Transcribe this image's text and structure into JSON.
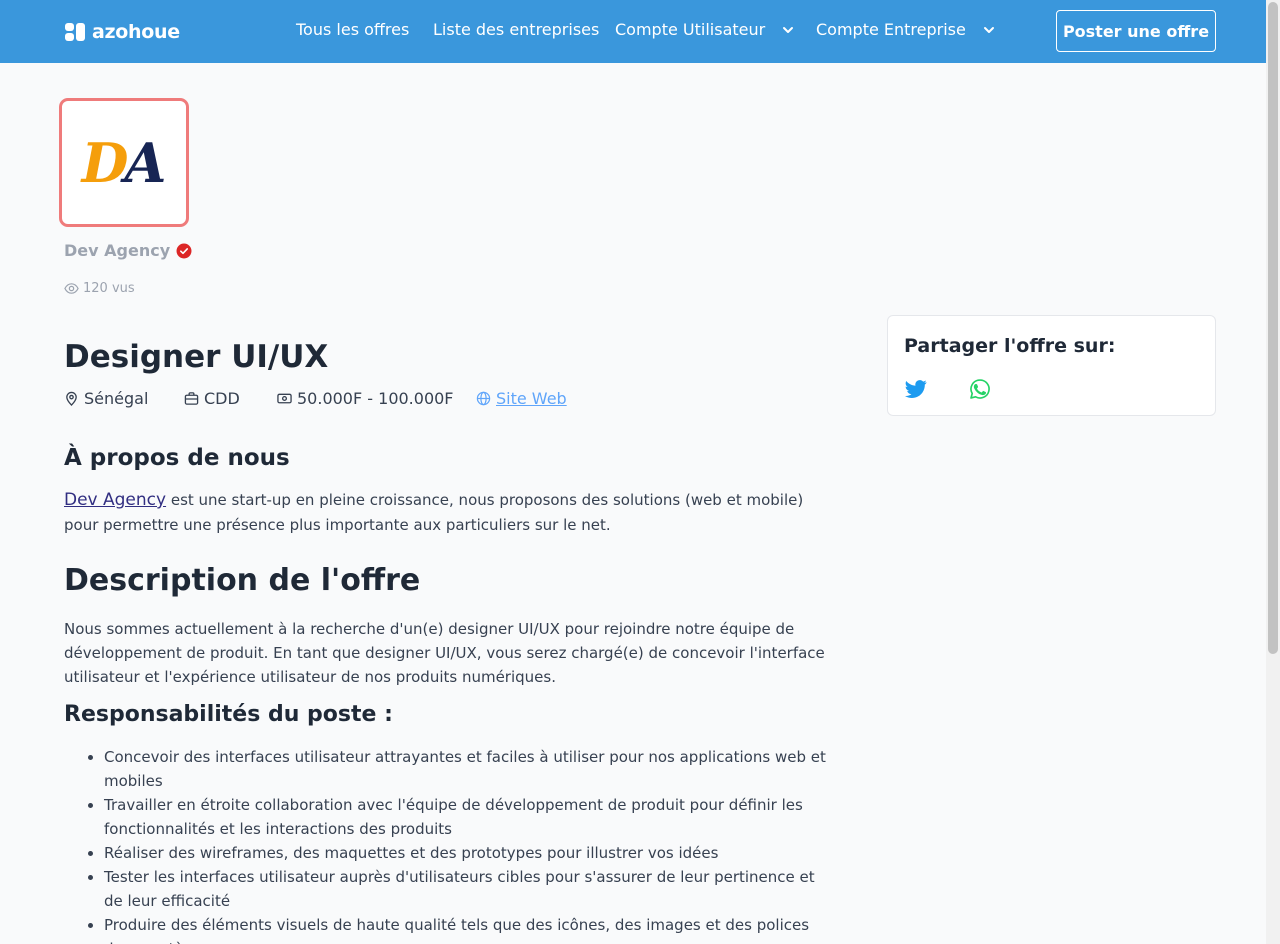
{
  "nav": {
    "brand": "azohoue",
    "items": [
      "Tous les offres",
      "Liste des entreprises",
      "Compte Utilisateur",
      "Compte Entreprise"
    ],
    "post_button": "Poster une offre"
  },
  "company": {
    "logo_letter_1": "D",
    "logo_letter_2": "A",
    "name": "Dev Agency",
    "views": "120 vus"
  },
  "job": {
    "title": "Designer UI/UX",
    "location": "Sénégal",
    "contract": "CDD",
    "salary": "50.000F - 100.000F",
    "website_label": "Site Web"
  },
  "about": {
    "heading": "À propos de nous",
    "company_link": "Dev Agency",
    "text": " est une start-up en pleine croissance, nous proposons des solutions (web et mobile) pour permettre une présence plus importante aux particuliers sur le net."
  },
  "description": {
    "heading": "Description de l'offre",
    "text": "Nous sommes actuellement à la recherche d'un(e) designer UI/UX pour rejoindre notre équipe de développement de produit. En tant que designer UI/UX, vous serez chargé(e) de concevoir l'interface utilisateur et l'expérience utilisateur de nos produits numériques.",
    "responsibilities_heading": "Responsabilités du poste :",
    "responsibilities": [
      "Concevoir des interfaces utilisateur attrayantes et faciles à utiliser pour nos applications web et mobiles",
      "Travailler en étroite collaboration avec l'équipe de développement de produit pour définir les fonctionnalités et les interactions des produits",
      "Réaliser des wireframes, des maquettes et des prototypes pour illustrer vos idées",
      "Tester les interfaces utilisateur auprès d'utilisateurs cibles pour s'assurer de leur pertinence et de leur efficacité",
      "Produire des éléments visuels de haute qualité tels que des icônes, des images et des polices de caractères"
    ]
  },
  "share": {
    "title": "Partager l'offre sur:",
    "icons": [
      "twitter-icon",
      "whatsapp-icon"
    ]
  },
  "colors": {
    "nav_bg": "#3a97dc",
    "logo_border": "#ef7b7b",
    "verified": "#dc2626",
    "twitter": "#1d9bf0",
    "whatsapp": "#25d366",
    "link": "#60a5fa"
  }
}
